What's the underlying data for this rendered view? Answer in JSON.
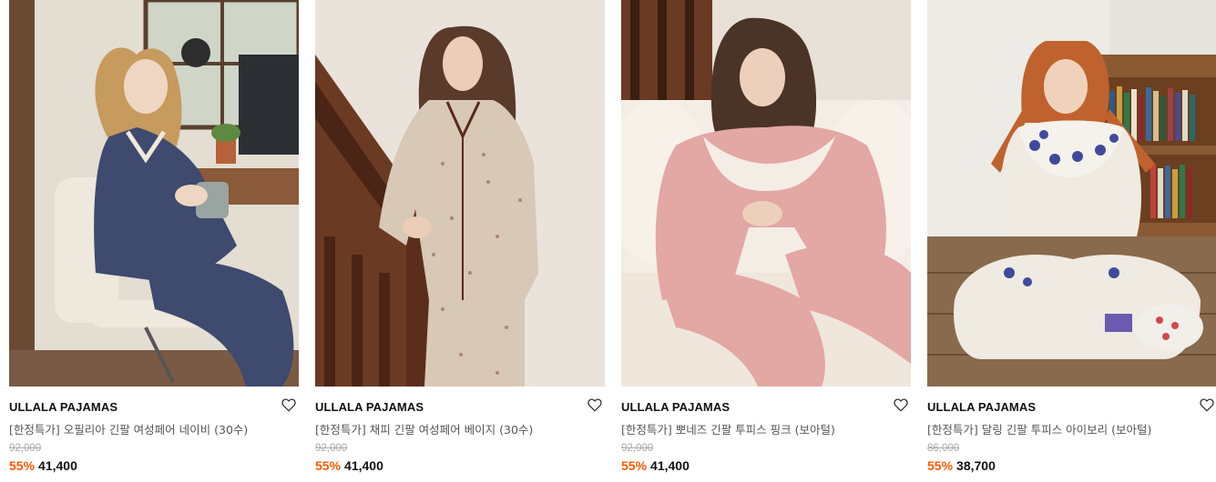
{
  "products": [
    {
      "brand": "ULLALA PAJAMAS",
      "title": "[한정특가] 오필리아 긴팔 여성페어 네이비 (30수)",
      "original_price": "92,000",
      "discount": "55%",
      "price": "41,400",
      "colors": {
        "bg": "#e3ddd2",
        "outfit": "#3e4a6e",
        "accent": "#c8b79a"
      }
    },
    {
      "brand": "ULLALA PAJAMAS",
      "title": "[한정특가] 채피 긴팔 여성페어 베이지 (30수)",
      "original_price": "92,000",
      "discount": "55%",
      "price": "41,400",
      "colors": {
        "bg": "#ece7e0",
        "outfit": "#d8c8b6",
        "accent": "#5b2a1a"
      }
    },
    {
      "brand": "ULLALA PAJAMAS",
      "title": "[한정특가] 뽀네즈 긴팔 투피스 핑크 (보아털)",
      "original_price": "92,000",
      "discount": "55%",
      "price": "41,400",
      "colors": {
        "bg": "#eee8e2",
        "outfit": "#e3a7a4",
        "accent": "#f4ede6"
      }
    },
    {
      "brand": "ULLALA PAJAMAS",
      "title": "[한정특가] 달링 긴팔 투피스 아이보리 (보아털)",
      "original_price": "86,000",
      "discount": "55%",
      "price": "38,700",
      "colors": {
        "bg": "#e6e4dd",
        "outfit": "#efeae2",
        "accent": "#3f4a9c"
      }
    }
  ]
}
